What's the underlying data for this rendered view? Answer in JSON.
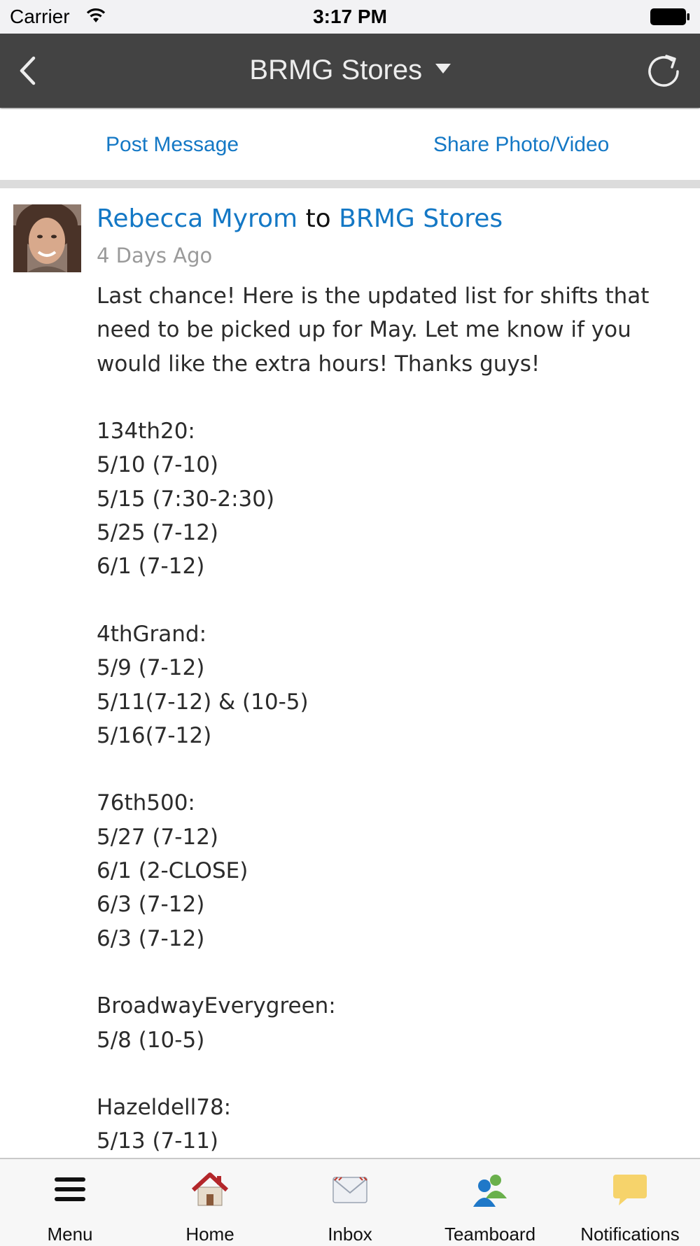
{
  "status_bar": {
    "carrier": "Carrier",
    "time": "3:17 PM"
  },
  "nav": {
    "title": "BRMG Stores"
  },
  "actions": {
    "post_message": "Post Message",
    "share_photo_video": "Share Photo/Video"
  },
  "post": {
    "author": "Rebecca Myrom",
    "to_word": "to",
    "group": "BRMG Stores",
    "time": "4 Days Ago",
    "body": "Last chance! Here is the updated list for shifts that need to be picked up for May. Let me know if you would like the extra hours! Thanks guys!\n\n134th20:\n5/10 (7-10)\n5/15 (7:30-2:30)\n5/25 (7-12)\n6/1 (7-12)\n\n4thGrand:\n5/9 (7-12)\n5/11(7-12) & (10-5)\n5/16(7-12)\n\n76th500:\n5/27 (7-12)\n6/1 (2-CLOSE)\n6/3 (7-12)\n6/3 (7-12)\n\nBroadwayEverygreen:\n5/8 (10-5)\n\nHazeldell78:\n5/13 (7-11)"
  },
  "tabs": [
    {
      "label": "Menu",
      "icon": "menu-icon"
    },
    {
      "label": "Home",
      "icon": "home-icon"
    },
    {
      "label": "Inbox",
      "icon": "inbox-icon"
    },
    {
      "label": "Teamboard",
      "icon": "teamboard-icon"
    },
    {
      "label": "Notifications",
      "icon": "notifications-icon"
    }
  ],
  "colors": {
    "nav_background": "#434343",
    "link": "#1478c5",
    "tab_bar_background": "#f7f7f7"
  }
}
